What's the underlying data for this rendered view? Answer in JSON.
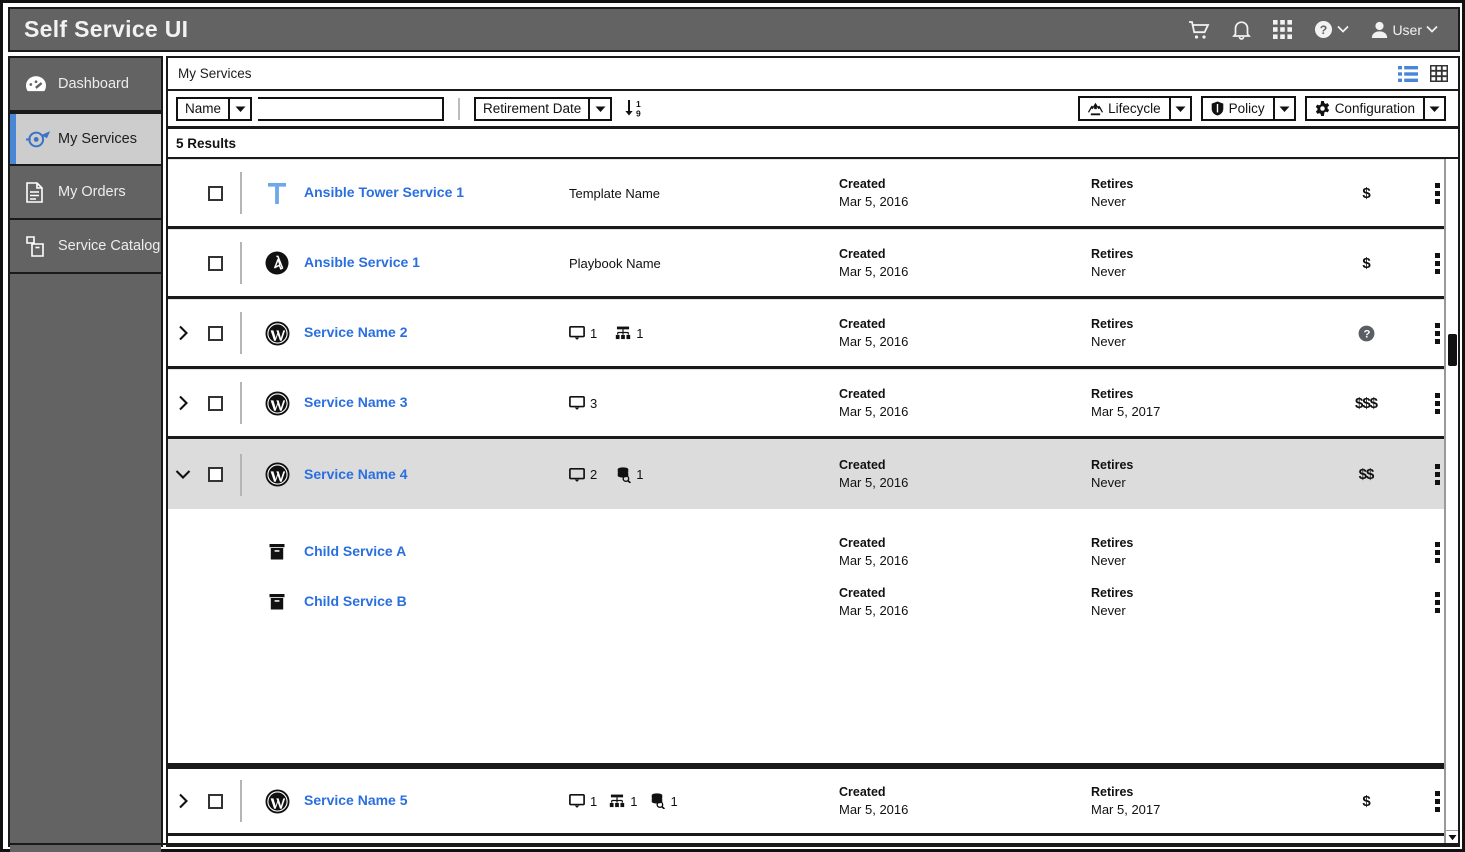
{
  "header": {
    "title": "Self Service UI",
    "icons": [
      {
        "name": "cart-icon",
        "label": ""
      },
      {
        "name": "bell-icon",
        "label": ""
      },
      {
        "name": "grid-apps-icon",
        "label": ""
      },
      {
        "name": "help-icon",
        "label": ""
      }
    ],
    "user_label": "User"
  },
  "sidebar": {
    "items": [
      {
        "label": "Dashboard",
        "icon": "dashboard-icon",
        "active": false
      },
      {
        "label": "My Services",
        "icon": "my-services-icon",
        "active": true
      },
      {
        "label": "My Orders",
        "icon": "my-orders-icon",
        "active": false
      },
      {
        "label": "Service Catalog",
        "icon": "service-catalog-icon",
        "active": false
      }
    ]
  },
  "breadcrumb": {
    "text": "My Services"
  },
  "view_toggle": {
    "list_label": "list-view",
    "grid_label": "grid-view",
    "active": "list-view",
    "active_color": "#4a86d6",
    "inactive_color": "#333333"
  },
  "toolbar": {
    "filter_field": "Name",
    "search_value": "",
    "search_placeholder": "",
    "sort_field": "Retirement Date",
    "sort_direction_label": "sort-ascending",
    "actions": [
      {
        "label": "Lifecycle",
        "icon": "recycle-icon"
      },
      {
        "label": "Policy",
        "icon": "shield-icon"
      },
      {
        "label": "Configuration",
        "icon": "gear-icon"
      }
    ]
  },
  "results": {
    "count_label": "5 Results"
  },
  "labels": {
    "created": "Created",
    "retires": "Retires"
  },
  "rows": [
    {
      "name": "Ansible Tower Service 1",
      "icon": "ansible-tower-icon",
      "expandable": false,
      "expanded": false,
      "checked": false,
      "subtitle": "Template Name",
      "resources": [],
      "created_label": "Created",
      "created_value": "Mar 5, 2016",
      "retires_label": "Retires",
      "retires_value": "Never",
      "cost": "$",
      "cost_type": "text",
      "highlight": false
    },
    {
      "name": "Ansible Service 1",
      "icon": "ansible-icon",
      "expandable": false,
      "expanded": false,
      "checked": false,
      "subtitle": "Playbook Name",
      "resources": [],
      "created_label": "Created",
      "created_value": "Mar 5, 2016",
      "retires_label": "Retires",
      "retires_value": "Never",
      "cost": "$",
      "cost_type": "text",
      "highlight": false
    },
    {
      "name": "Service Name 2",
      "icon": "wordpress-icon",
      "expandable": true,
      "expanded": false,
      "checked": false,
      "subtitle": "",
      "resources": [
        {
          "icon": "monitor-icon",
          "count": "1"
        },
        {
          "icon": "network-icon",
          "count": "1"
        }
      ],
      "created_label": "Created",
      "created_value": "Mar 5, 2016",
      "retires_label": "Retires",
      "retires_value": "Never",
      "cost": "",
      "cost_type": "unknown-icon",
      "highlight": false
    },
    {
      "name": "Service Name 3",
      "icon": "wordpress-icon",
      "expandable": true,
      "expanded": false,
      "checked": false,
      "subtitle": "",
      "resources": [
        {
          "icon": "monitor-icon",
          "count": "3"
        }
      ],
      "created_label": "Created",
      "created_value": "Mar 5, 2016",
      "retires_label": "Retires",
      "retires_value": "Mar 5, 2017",
      "cost": "$$$",
      "cost_type": "text",
      "highlight": false
    },
    {
      "name": "Service Name 4",
      "icon": "wordpress-icon",
      "expandable": true,
      "expanded": true,
      "checked": false,
      "subtitle": "",
      "resources": [
        {
          "icon": "monitor-icon",
          "count": "2"
        },
        {
          "icon": "database-search-icon",
          "count": "1"
        }
      ],
      "created_label": "Created",
      "created_value": "Mar 5, 2016",
      "retires_label": "Retires",
      "retires_value": "Never",
      "cost": "$$",
      "cost_type": "text",
      "highlight": true,
      "children": [
        {
          "name": "Child Service A",
          "icon": "server-box-icon",
          "created_label": "Created",
          "created_value": "Mar 5, 2016",
          "retires_label": "Retires",
          "retires_value": "Never"
        },
        {
          "name": "Child Service B",
          "icon": "server-box-icon",
          "created_label": "Created",
          "created_value": "Mar 5, 2016",
          "retires_label": "Retires",
          "retires_value": "Never"
        }
      ]
    },
    {
      "name": "Service Name 5",
      "icon": "wordpress-icon",
      "expandable": true,
      "expanded": false,
      "checked": false,
      "subtitle": "",
      "resources": [
        {
          "icon": "monitor-icon",
          "count": "1"
        },
        {
          "icon": "network-icon",
          "count": "1"
        },
        {
          "icon": "database-search-icon",
          "count": "1"
        }
      ],
      "created_label": "Created",
      "created_value": "Mar 5, 2016",
      "retires_label": "Retires",
      "retires_value": "Mar 5, 2017",
      "cost": "$",
      "cost_type": "text",
      "highlight": false
    }
  ],
  "colors": {
    "chrome": "#636363",
    "link": "#2a6fe0",
    "accent": "#4a86d6",
    "row_highlight": "#dcdcdc"
  }
}
